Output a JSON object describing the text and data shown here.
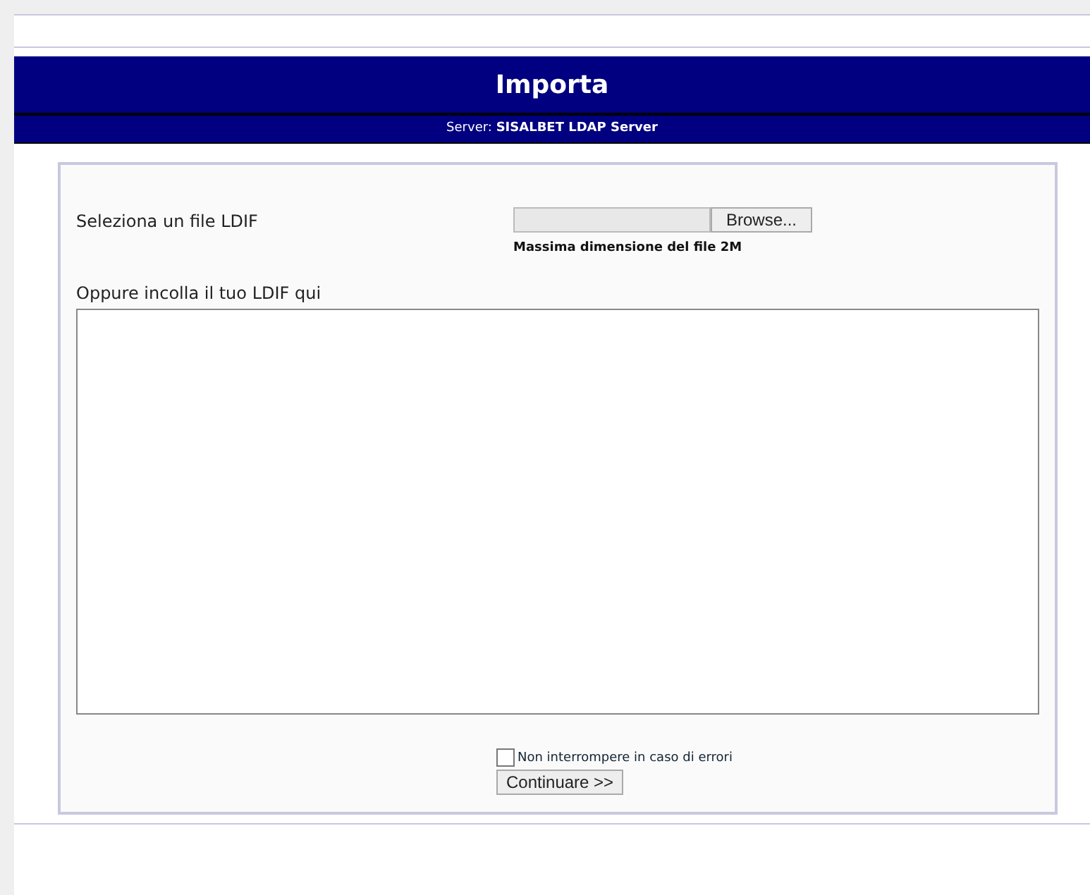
{
  "header": {
    "title": "Importa",
    "server_label": "Server:",
    "server_name": "SISALBET LDAP Server"
  },
  "form": {
    "file_label": "Seleziona un file LDIF",
    "browse_button": "Browse...",
    "max_size_note": "Massima dimensione del file 2M",
    "paste_label": "Oppure incolla il tuo LDIF qui",
    "continue_on_error": {
      "label": "Non interrompere in caso di errori",
      "checked": false
    },
    "submit_button": "Continuare >>"
  }
}
